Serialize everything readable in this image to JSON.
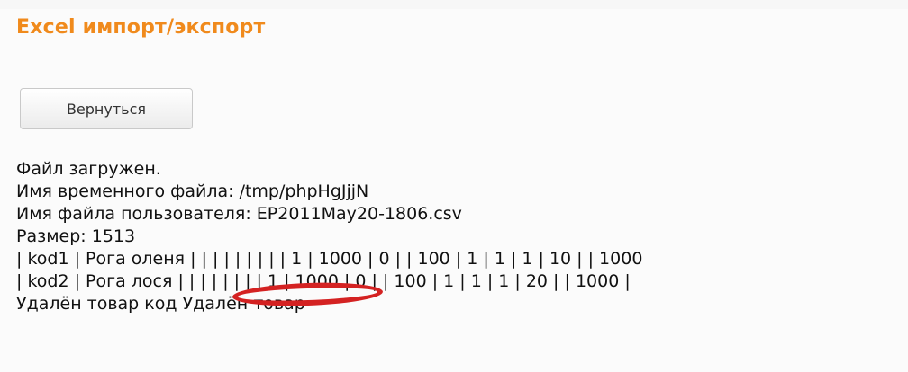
{
  "page": {
    "title": "Excel импорт/экспорт"
  },
  "actions": {
    "back_label": "Вернуться"
  },
  "upload_log": {
    "lines": [
      "Файл загружен.",
      "Имя временного файла: /tmp/phpHgJjjN",
      "Имя файла пользователя: EP2011May20-1806.csv",
      "Размер: 1513",
      "| kod1 | Рога оленя | | | | | | | | | 1 | 1000 | 0 | | 100 | 1 | 1 | 1 | 10 | | 1000",
      "| kod2 | Рога лося | | | | | | | | 1 | 1000 | 0 | | 100 | 1 | 1 | 1 | 20 | | 1000 |",
      "Удалён товар код Удалён товар"
    ]
  },
  "annotation": {
    "color": "#d42222"
  },
  "colors": {
    "title": "#f08a1c",
    "text": "#111111",
    "background": "#fbfbfb"
  }
}
